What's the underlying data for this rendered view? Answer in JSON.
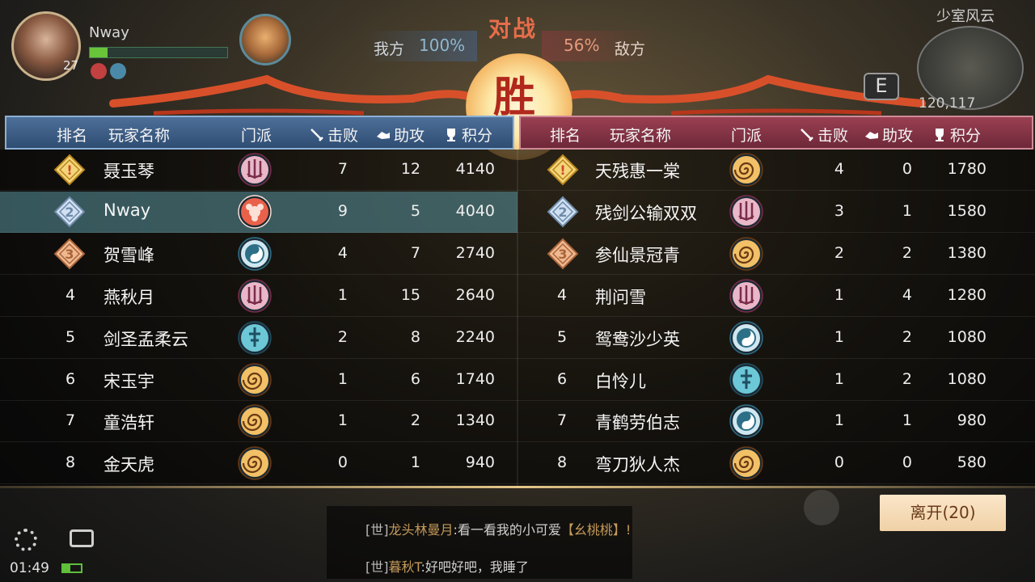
{
  "hud": {
    "player_name": "Nway",
    "level": "27",
    "zone": "少室风云",
    "coords": "120,117",
    "exit_glyph": "E"
  },
  "versus": {
    "label": "对战",
    "our_label": "我方",
    "our_pct": "100%",
    "enemy_label": "敌方",
    "enemy_pct": "56%",
    "result": "胜"
  },
  "headers": {
    "rank": "排名",
    "player": "玩家名称",
    "sect": "门派",
    "kills": "击败",
    "assists": "助攻",
    "score": "积分"
  },
  "colors": {
    "ally_header": "#3d5e88",
    "enemy_header": "#8a3447",
    "highlight_row": "#4f8f98",
    "leave_button": "#f6dcb8"
  },
  "ally": [
    {
      "rank": "1",
      "name": "聂玉琴",
      "sect": "trident-pink",
      "kills": "7",
      "assists": "12",
      "score": "4140"
    },
    {
      "rank": "2",
      "name": "Nway",
      "sect": "flower-red",
      "kills": "9",
      "assists": "5",
      "score": "4040"
    },
    {
      "rank": "3",
      "name": "贺雪峰",
      "sect": "taiji-blue",
      "kills": "4",
      "assists": "7",
      "score": "2740"
    },
    {
      "rank": "4",
      "name": "燕秋月",
      "sect": "trident-pink",
      "kills": "1",
      "assists": "15",
      "score": "2640"
    },
    {
      "rank": "5",
      "name": "剑圣孟柔云",
      "sect": "sword-cyan",
      "kills": "2",
      "assists": "8",
      "score": "2240"
    },
    {
      "rank": "6",
      "name": "宋玉宇",
      "sect": "swirl-gold",
      "kills": "1",
      "assists": "6",
      "score": "1740"
    },
    {
      "rank": "7",
      "name": "童浩轩",
      "sect": "swirl-gold",
      "kills": "1",
      "assists": "2",
      "score": "1340"
    },
    {
      "rank": "8",
      "name": "金天虎",
      "sect": "swirl-gold",
      "kills": "0",
      "assists": "1",
      "score": "940"
    }
  ],
  "enemy": [
    {
      "rank": "1",
      "name": "天残惠一棠",
      "sect": "swirl-gold",
      "kills": "4",
      "assists": "0",
      "score": "1780"
    },
    {
      "rank": "2",
      "name": "残剑公输双双",
      "sect": "trident-pink",
      "kills": "3",
      "assists": "1",
      "score": "1580"
    },
    {
      "rank": "3",
      "name": "参仙景冠青",
      "sect": "swirl-gold",
      "kills": "2",
      "assists": "2",
      "score": "1380"
    },
    {
      "rank": "4",
      "name": "荆问雪",
      "sect": "trident-pink",
      "kills": "1",
      "assists": "4",
      "score": "1280"
    },
    {
      "rank": "5",
      "name": "鸳鸯沙少英",
      "sect": "taiji-blue",
      "kills": "1",
      "assists": "2",
      "score": "1080"
    },
    {
      "rank": "6",
      "name": "白怜儿",
      "sect": "sword-cyan",
      "kills": "1",
      "assists": "2",
      "score": "1080"
    },
    {
      "rank": "7",
      "name": "青鹤劳伯志",
      "sect": "taiji-blue",
      "kills": "1",
      "assists": "1",
      "score": "980"
    },
    {
      "rank": "8",
      "name": "弯刀狄人杰",
      "sect": "swirl-gold",
      "kills": "0",
      "assists": "0",
      "score": "580"
    }
  ],
  "highlight_ally_index": 1,
  "leave_button": "离开(20)",
  "chat": [
    {
      "channel": "[世]",
      "who": "龙头林曼月",
      "msg": ":看一看我的小可爱",
      "extra": "【幺桃桃】!"
    },
    {
      "channel": "[世]",
      "who": "暮秋T",
      "msg": ":好吧好吧，我睡了",
      "extra": ""
    }
  ],
  "status": {
    "time": "01:49"
  }
}
